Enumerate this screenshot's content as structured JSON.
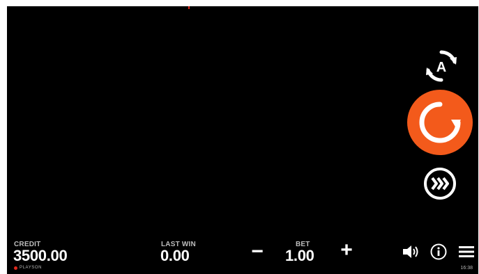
{
  "colors": {
    "accent": "#f35a1b",
    "background": "#000000",
    "text": "#ffffff",
    "muted": "#bdbdbd"
  },
  "controls": {
    "autoplay": {
      "icon": "autoplay-icon",
      "label": "A"
    },
    "spin": {
      "icon": "spin-icon"
    },
    "turbo": {
      "icon": "turbo-icon"
    }
  },
  "bottom_bar": {
    "credit_label": "CREDIT",
    "credit_value": "3500.00",
    "last_win_label": "LAST WIN",
    "last_win_value": "0.00",
    "bet_label": "BET",
    "bet_value": "1.00",
    "bet_minus": "−",
    "bet_plus": "+",
    "sound_icon": "speaker-icon",
    "info_icon": "info-icon",
    "menu_icon": "hamburger-menu-icon",
    "brand": "PLAYSON",
    "clock": "16:38"
  }
}
